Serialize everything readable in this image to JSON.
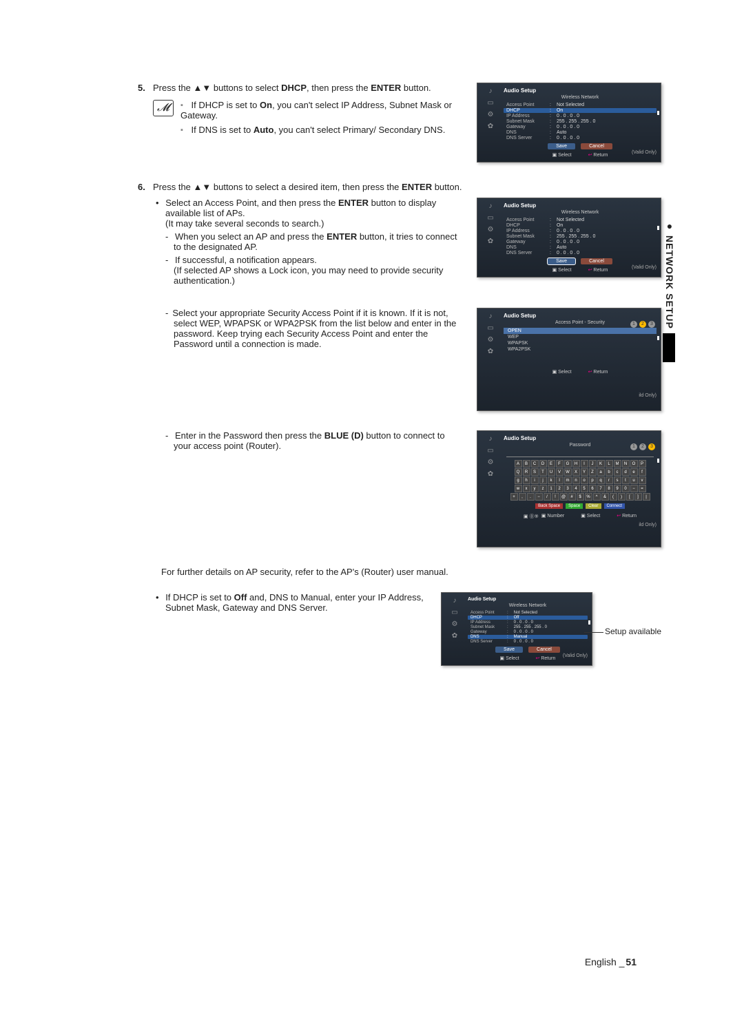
{
  "side_tab": "NETWORK SETUP",
  "step5": {
    "num": "5.",
    "text_a": "Press the ▲▼ buttons to select ",
    "dhcp": "DHCP",
    "text_b": ", then press the ",
    "enter": "ENTER",
    "text_c": " button."
  },
  "notes": {
    "n1_a": "If DHCP is set to ",
    "n1_on": "On",
    "n1_b": ", you can't select IP Address, Subnet Mask or Gateway.",
    "n2_a": "If DNS is set to ",
    "n2_auto": "Auto",
    "n2_b": ", you can't select Primary/ Secondary DNS."
  },
  "step6": {
    "num": "6.",
    "text_a": "Press the ▲▼ buttons to select a desired item, then press the ",
    "enter": "ENTER",
    "text_b": " button.",
    "b1_a": "Select an Access Point, and then press the ",
    "b1_enter": "ENTER",
    "b1_b": " button to display available list of APs.",
    "b1_c": "(It may take several seconds to search.)",
    "d1_a": "When you select an AP and press the ",
    "d1_enter": "ENTER",
    "d1_b": " button, it tries to connect to the designated AP.",
    "d2_a": "If successful, a notification appears.",
    "d2_b": "(If selected AP shows a Lock icon, you may need to provide security authentication.)",
    "d3": "Select your appropriate Security Access Point if it is known. If it is not, select WEP, WPAPSK or WPA2PSK from the list below and enter in the password. Keep trying each Security Access Point and enter the Password until a connection is made.",
    "d4_a": "Enter in the Password then press the ",
    "d4_blue": "BLUE (D)",
    "d4_b": " button to connect to your access point (Router)."
  },
  "further": "For further details on AP security, refer to the AP's (Router) user manual.",
  "bottom": {
    "b1_a": "If DHCP is set to ",
    "off": "Off",
    "b1_b": " and, DNS to Manual, enter your IP Address, Subnet Mask, Gateway and DNS Server.",
    "callout": "Setup available"
  },
  "panel": {
    "crumb": "Music",
    "title": "Audio Setup",
    "subtitle": "Wireless Network",
    "sec_subtitle": "Access Point - Security",
    "pw_subtitle": "Password",
    "rows": {
      "ap_label": "Access Point",
      "ap_val": "Not Selected",
      "dhcp_label": "DHCP",
      "dhcp_on": "On",
      "dhcp_off": "Off",
      "ip_label": "IP Address",
      "ip_val": "0 . 0 . 0 . 0",
      "sn_label": "Subnet Mask",
      "sn_val": "255 . 255 . 255 . 0",
      "gw_label": "Gateway",
      "gw_val": "0 . 0 . 0 . 0",
      "dns_label": "DNS",
      "dns_auto": "Auto",
      "dns_manual": "Manual",
      "dnssrv_label": "DNS Server",
      "dnssrv_val": "0 . 0 . 0 . 0"
    },
    "save": "Save",
    "cancel": "Cancel",
    "select": "Select",
    "return": "Return",
    "number": "Number",
    "valid": "(Valid Only)",
    "sec": {
      "open": "OPEN",
      "wep": "WEP",
      "wpapsk": "WPAPSK",
      "wpa2psk": "WPA2PSK"
    },
    "kb_special": {
      "back": "Back Space",
      "space": "Space",
      "clear": "Clear",
      "connect": "Connect"
    }
  },
  "footer": {
    "lang": "English ",
    "sep": "_",
    "page": "51"
  },
  "keyboard_rows": [
    [
      "A",
      "B",
      "C",
      "D",
      "E",
      "F",
      "G",
      "H",
      "I",
      "J",
      "K",
      "L",
      "M",
      "N",
      "O",
      "P"
    ],
    [
      "Q",
      "R",
      "S",
      "T",
      "U",
      "V",
      "W",
      "X",
      "Y",
      "Z",
      "a",
      "b",
      "c",
      "d",
      "e",
      "f"
    ],
    [
      "g",
      "h",
      "i",
      "j",
      "k",
      "l",
      "m",
      "n",
      "o",
      "p",
      "q",
      "r",
      "s",
      "t",
      "u",
      "v"
    ],
    [
      "w",
      "x",
      "y",
      "z",
      "1",
      "2",
      "3",
      "4",
      "5",
      "6",
      "7",
      "8",
      "9",
      "0",
      "−",
      "="
    ],
    [
      "+",
      ",",
      ".",
      "−",
      "/",
      "!",
      "@",
      "#",
      "$",
      "%",
      "^",
      "&",
      "(",
      ")",
      "[",
      "]",
      "|"
    ]
  ]
}
